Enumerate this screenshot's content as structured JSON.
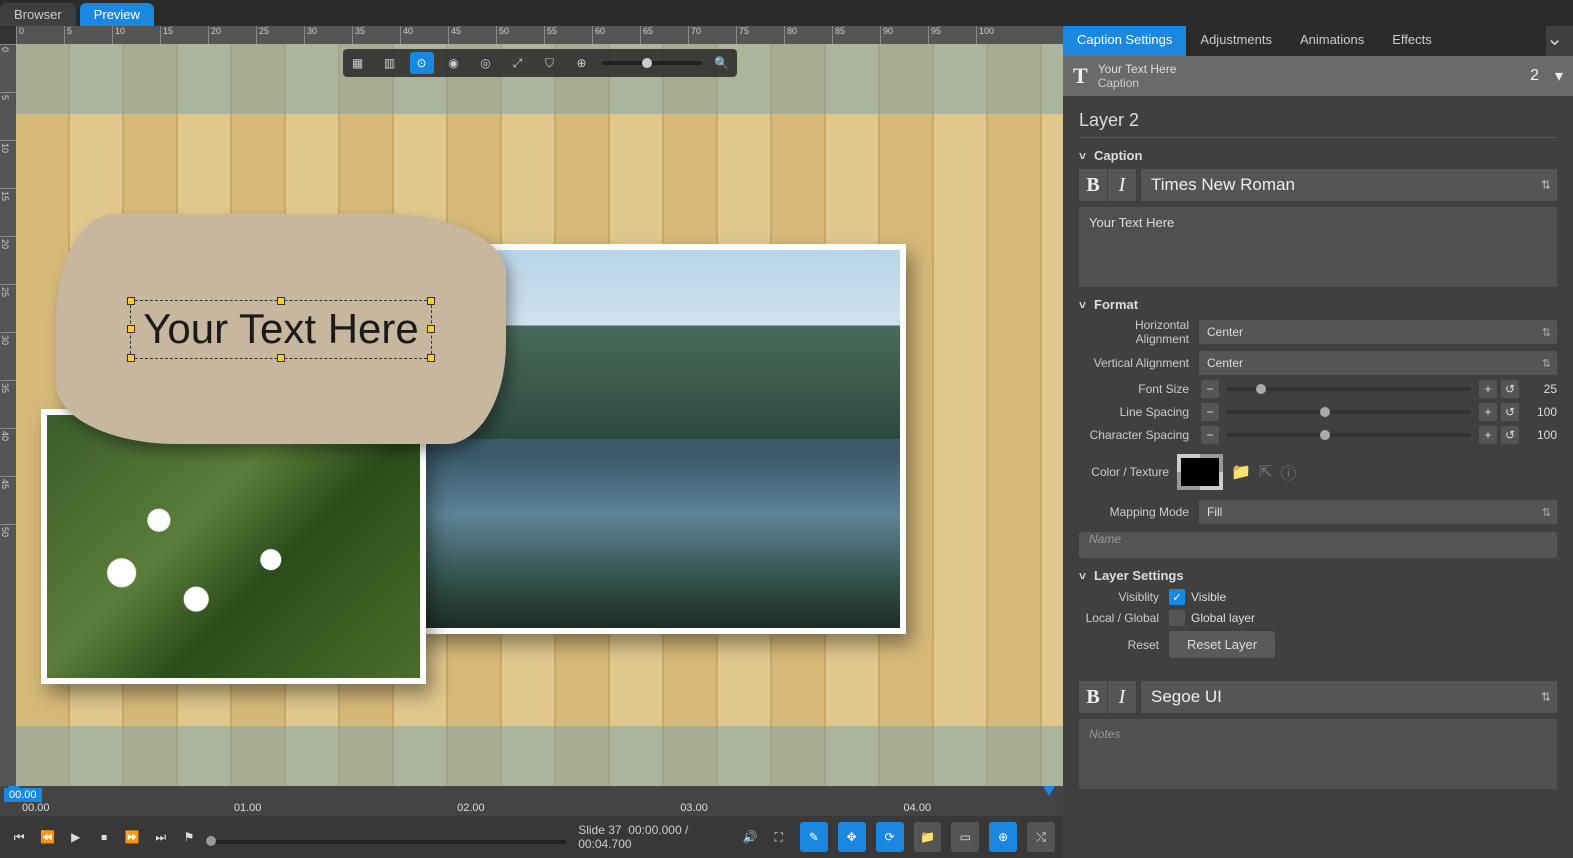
{
  "topTabs": {
    "browser": "Browser",
    "preview": "Preview"
  },
  "panelTabs": {
    "caption": "Caption Settings",
    "adjustments": "Adjustments",
    "animations": "Animations",
    "effects": "Effects"
  },
  "layerBar": {
    "title": "Your Text Here",
    "sub": "Caption",
    "num": "2"
  },
  "layerTitle": "Layer 2",
  "sectCaption": "Caption",
  "sectFormat": "Format",
  "sectLayer": "Layer Settings",
  "fontMain": "Times New Roman",
  "textContent": "Your Text Here",
  "canvasText": "Your Text Here",
  "hAlign": {
    "label": "Horizontal Alignment",
    "value": "Center"
  },
  "vAlign": {
    "label": "Vertical Alignment",
    "value": "Center"
  },
  "fontSize": {
    "label": "Font Size",
    "value": "25"
  },
  "lineSpacing": {
    "label": "Line Spacing",
    "value": "100"
  },
  "charSpacing": {
    "label": "Character Spacing",
    "value": "100"
  },
  "colorTexture": "Color / Texture",
  "mappingMode": {
    "label": "Mapping Mode",
    "value": "Fill"
  },
  "namePlaceholder": "Name",
  "visibility": {
    "label": "Visiblity",
    "text": "Visible"
  },
  "localGlobal": {
    "label": "Local / Global",
    "text": "Global layer"
  },
  "reset": {
    "label": "Reset",
    "button": "Reset Layer"
  },
  "fontNotes": "Segoe UI",
  "notesPlaceholder": "Notes",
  "timeMarks": [
    "00.00",
    "01.00",
    "02.00",
    "03.00",
    "04.00"
  ],
  "slideInfo": {
    "slide": "Slide 37",
    "cur": "00:00.000",
    "total": "00:04.700"
  },
  "timeCursor": "00.00"
}
